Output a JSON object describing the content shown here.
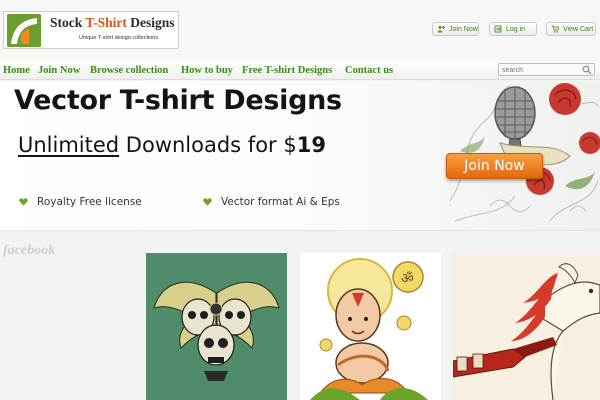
{
  "header": {
    "logo": {
      "title_main": "Stock ",
      "title_accent": "T-Shirt",
      "title_rest": " Designs",
      "tagline": "Unique T-shirt design collections"
    },
    "buttons": {
      "join": "Join Now",
      "login": "Log in",
      "cart": "View Cart"
    }
  },
  "nav": {
    "items": [
      "Home",
      "Join Now",
      "Browse collection",
      "How to buy",
      "Free T-shirt Designs",
      "Contact us"
    ],
    "search_placeholder": "search"
  },
  "banner": {
    "title": "Vector T-shirt Designs",
    "line2_underlined": "Unlimited",
    "line2_middle": " Downloads for $",
    "line2_price": "19",
    "features": [
      "Royalty Free license",
      "Vector format Ai & Eps"
    ],
    "cta": "Join Now"
  },
  "social": {
    "label": "facebook"
  },
  "colors": {
    "nav_green": "#3a8c1a",
    "accent_orange": "#e2670e",
    "heart_green": "#6aa52a"
  },
  "icons": [
    "logo-mark-icon",
    "user-plus-icon",
    "login-icon",
    "cart-icon",
    "search-icon",
    "heart-icon"
  ]
}
